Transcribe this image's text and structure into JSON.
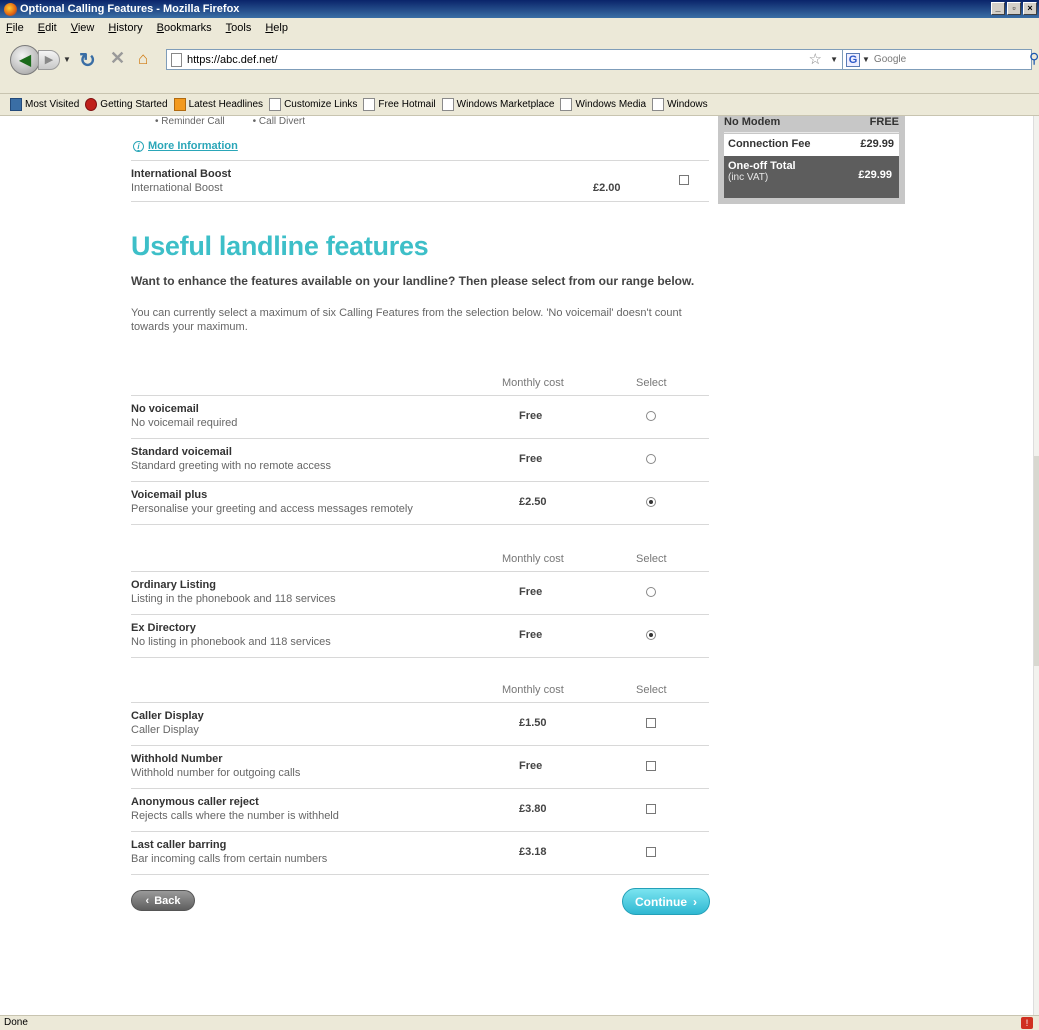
{
  "window": {
    "title": "Optional Calling Features - Mozilla Firefox",
    "controls": [
      "_",
      "▫",
      "×"
    ]
  },
  "menu": [
    "File",
    "Edit",
    "View",
    "History",
    "Bookmarks",
    "Tools",
    "Help"
  ],
  "nav": {
    "url": "https://abc.def.net/",
    "search_placeholder": "Google"
  },
  "bookmarks": [
    "Most Visited",
    "Getting Started",
    "Latest Headlines",
    "Customize Links",
    "Free Hotmail",
    "Windows Marketplace",
    "Windows Media",
    "Windows"
  ],
  "status": {
    "text": "Done"
  },
  "page": {
    "bullets": [
      "Reminder Call",
      "Call Divert"
    ],
    "more_info": "More Information",
    "intl": {
      "title": "International Boost",
      "subtitle": "International Boost",
      "cost": "£2.00",
      "checked": false
    },
    "summary": {
      "rows": [
        {
          "label": "No Modem",
          "value": "FREE"
        },
        {
          "label": "Connection Fee",
          "value": "£29.99"
        }
      ],
      "total_label": "One-off Total",
      "total_sub": "(inc VAT)",
      "total_value": "£29.99"
    },
    "heading": "Useful landline features",
    "intro": "Want to enhance the features available on your landline? Then please select from our range below.",
    "note": "You can currently select a maximum of six Calling Features from the selection below. 'No voicemail' doesn't count towards your maximum.",
    "col_cost": "Monthly cost",
    "col_select": "Select",
    "groups": [
      {
        "type": "radio",
        "rows": [
          {
            "title": "No voicemail",
            "subtitle": "No voicemail required",
            "cost": "Free",
            "selected": false
          },
          {
            "title": "Standard voicemail",
            "subtitle": "Standard greeting with no remote access",
            "cost": "Free",
            "selected": false
          },
          {
            "title": "Voicemail plus",
            "subtitle": "Personalise your greeting and access messages remotely",
            "cost": "£2.50",
            "selected": true
          }
        ]
      },
      {
        "type": "radio",
        "rows": [
          {
            "title": "Ordinary Listing",
            "subtitle": "Listing in the phonebook and 118 services",
            "cost": "Free",
            "selected": false
          },
          {
            "title": "Ex Directory",
            "subtitle": "No listing in phonebook and 118 services",
            "cost": "Free",
            "selected": true
          }
        ]
      },
      {
        "type": "checkbox",
        "rows": [
          {
            "title": "Caller Display",
            "subtitle": "Caller Display",
            "cost": "£1.50",
            "selected": false
          },
          {
            "title": "Withhold Number",
            "subtitle": "Withhold number for outgoing calls",
            "cost": "Free",
            "selected": false
          },
          {
            "title": "Anonymous caller reject",
            "subtitle": "Rejects calls where the number is withheld",
            "cost": "£3.80",
            "selected": false
          },
          {
            "title": "Last caller barring",
            "subtitle": "Bar incoming calls from certain numbers",
            "cost": "£3.18",
            "selected": false
          }
        ]
      }
    ],
    "back_label": "Back",
    "continue_label": "Continue"
  }
}
